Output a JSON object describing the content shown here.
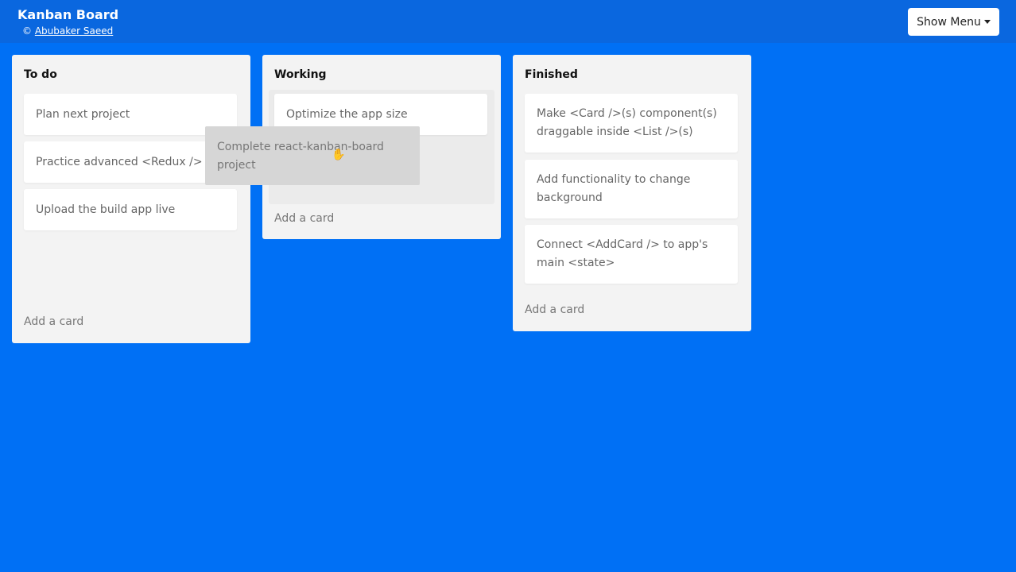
{
  "header": {
    "title": "Kanban Board",
    "copyright": "©",
    "author": "Abubaker Saeed",
    "menu_button": "Show Menu"
  },
  "lists": [
    {
      "title": "To do",
      "cards": [
        "Plan next project",
        "Practice advanced <Redux />",
        "Upload the build app live"
      ],
      "add": "Add a card"
    },
    {
      "title": "Working",
      "cards": [
        "Optimize the app size"
      ],
      "add": "Add a card"
    },
    {
      "title": "Finished",
      "cards": [
        "Make <Card />(s) component(s) draggable inside <List />(s)",
        "Add functionality to change background",
        "Connect <AddCard /> to app's main <state>"
      ],
      "add": "Add a card"
    }
  ],
  "dragging_card": "Complete react-kanban-board project",
  "colors": {
    "background": "#0070f5",
    "header": "#0a67df",
    "list": "#f3f3f3"
  }
}
